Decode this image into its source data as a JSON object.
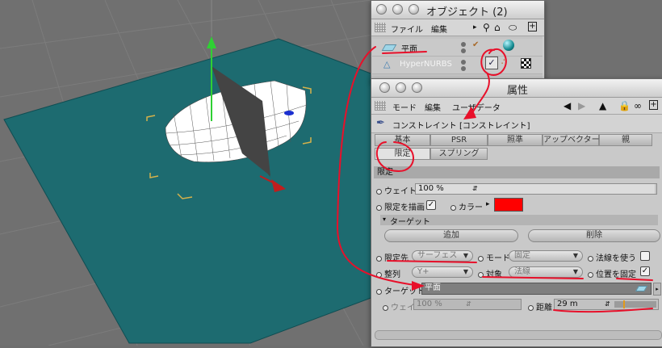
{
  "object_manager": {
    "title": "オブジェクト (2)",
    "menu": [
      "ファイル",
      "編集"
    ],
    "objects": [
      {
        "name": "平面"
      },
      {
        "name": "HyperNURBS"
      }
    ]
  },
  "attributes": {
    "title": "属性",
    "menu": [
      "モード",
      "編集",
      "ユーザデータ"
    ],
    "tag_title": "コンストレイント [コンストレイント]",
    "tabs_row1": [
      "基本",
      "PSR",
      "照準",
      "アップベクター",
      "親"
    ],
    "tabs_row2": [
      "限定",
      "スプリング"
    ],
    "active_tab": "限定",
    "section_title": "限定",
    "weight_label": "ウェイト",
    "weight_value": "100 %",
    "weight_fraction": 1.0,
    "draw_limit_label": "限定を描画",
    "draw_limit_checked": true,
    "color_label": "カラー",
    "color_value": "#ff0000",
    "target_group": "ターゲット",
    "add_button": "追加",
    "delete_button": "削除",
    "limit_to_label": "限定先",
    "limit_to_value": "サーフェス",
    "mode_label": "モード",
    "mode_value": "固定",
    "use_normal_label": "法線を使う",
    "use_normal_checked": false,
    "align_label": "整列",
    "align_value": "Y+",
    "target_axis_label": "対象",
    "target_axis_value": "法線",
    "lock_pos_label": "位置を固定",
    "lock_pos_checked": true,
    "target_label": "ターゲット",
    "target_value": "平面",
    "weight2_label": "ウェイト",
    "weight2_value": "100 %",
    "distance_label": "距離",
    "distance_value": "29 m",
    "distance_fraction": 0.22
  },
  "colors": {
    "annotation": "#e8102a",
    "plane": "#1d6b70",
    "swatch": "#ff0000"
  }
}
